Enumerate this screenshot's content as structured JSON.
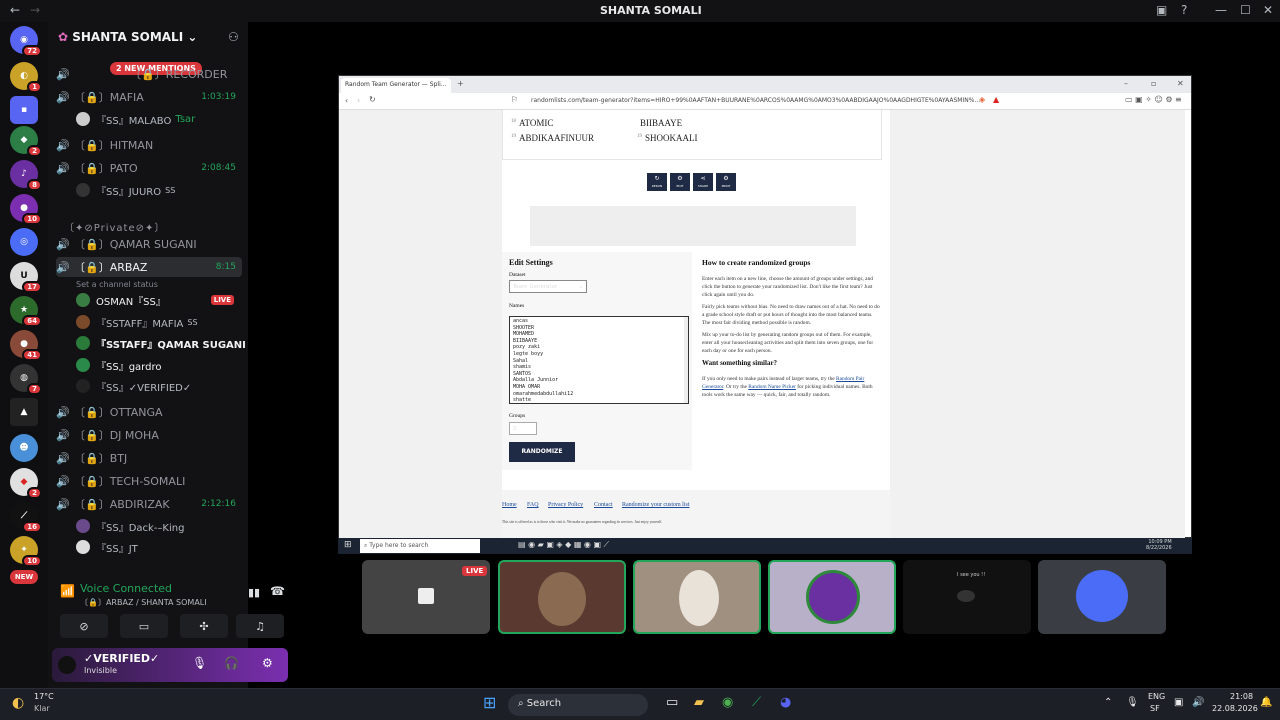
{
  "window": {
    "title": "SHANTA SOMALI"
  },
  "server": {
    "name": "SHANTA SOMALI",
    "mentions": "2 NEW MENTIONS"
  },
  "channels": [
    {
      "name": "〔🔒〕RECORDER",
      "time": ""
    },
    {
      "name": "〔🔒〕MAFIA",
      "time": "1:03:19"
    },
    {
      "name": "〔🔒〕HITMAN",
      "time": ""
    },
    {
      "name": "〔🔒〕PATO",
      "time": "2:08:45"
    },
    {
      "name": "〔🔒〕QAMAR SUGANI",
      "time": ""
    },
    {
      "name": "〔🔒〕ARBAZ",
      "time": "8:15"
    },
    {
      "name": "〔🔒〕OTTANGA",
      "time": ""
    },
    {
      "name": "〔🔒〕DJ MOHA",
      "time": ""
    },
    {
      "name": "〔🔒〕BTJ",
      "time": ""
    },
    {
      "name": "〔🔒〕TECH-SOMALI",
      "time": ""
    },
    {
      "name": "〔🔒〕ABDIRIZAK",
      "time": "2:12:16"
    }
  ],
  "category_private": "〔✦⊘Private⊘✦〕",
  "users": {
    "malabo": "『SS』MALABO",
    "malabo_tag": "Tsar",
    "juuro": "『SS』JUURO",
    "osman": "OSMAN『SS』",
    "live": "LIVE",
    "status_hint": "Set a channel status",
    "staff_mafia": "『SSTAFF』MAFIA",
    "staff_qamar": "『SSTAFF』QAMAR SUGANI",
    "gardro": "『SS』gardro",
    "verified": "『SS』✓VERIFIED✓",
    "dark": "『SS』Dack-–King",
    "jt": "『SS』JT",
    "ss_tag": "SS"
  },
  "voice": {
    "connected": "Voice Connected",
    "where": "〔🔒〕ARBAZ / SHANTA SOMALI"
  },
  "me": {
    "name": "✓VERIFIED✓",
    "status": "Invisible"
  },
  "browser": {
    "tab": "Random Team Generator — Spli...",
    "url": "randomlists.com/team-generator?items=HIRO+99%0AAFTAN+BUURANE%0ARCOS%0AAMG%0AMO3%0AABDIGAAJO%0AAGDHIGTE%0AYAASMIN%..."
  },
  "teams": [
    {
      "n": "18",
      "name": "ATOMIC"
    },
    {
      "n": "19",
      "name": "ABDIKAAFINUUR"
    },
    {
      "n": "",
      "name": "BIIBAAYE"
    },
    {
      "n": "19",
      "name": "SHOOKAALI"
    }
  ],
  "toolbar": [
    "RERUN",
    "EDIT",
    "SHARE",
    "PRINT"
  ],
  "edit": {
    "title": "Edit Settings",
    "dataset_label": "Dataset",
    "dataset": "Team Generator",
    "names_label": "Names",
    "names": [
      "ancas",
      "SHOOTER",
      "MOHAMED",
      "BIIBAAYE",
      "pozy zaki",
      "legte boyy",
      "Sahal",
      "shamis",
      "SANTOS",
      "Abdalla Junnior",
      "MOHA OMAR",
      "omarahmedabdullahi12",
      "shatte"
    ],
    "groups_label": "Groups",
    "groups": "2",
    "randomize": "RANDOMIZE"
  },
  "howto": {
    "title": "How to create randomized groups",
    "p1": "Enter each item on a new line, choose the amount of groups under settings, and click the button to generate your randomized list. Don't like the first team? Just click again until you do.",
    "p2": "Fairly pick teams without bias. No need to draw names out of a hat. No need to do a grade school style draft or put hours of thought into the most balanced teams. The most fair dividing method possible is random.",
    "p3": "Mix up your to-do list by generating random groups out of them. For example, enter all your housecleaning activities and split them into seven groups, one for each day or one for each person.",
    "title2": "Want something similar?",
    "p4a": "If you only need to make pairs instead of larger teams, try the ",
    "link1": "Random Pair Generator",
    "p4b": ". Or try the ",
    "link2": "Random Name Picker",
    "p4c": " for picking individual names. Both tools work the same way — quick, fair, and totally random."
  },
  "footer": {
    "links": [
      "Home",
      "FAQ",
      "Privacy Policy",
      "Contact",
      "Randomize your custom list"
    ],
    "note": "This site is offered as is to those who visit it. We make no guarantees regarding its services. Just enjoy yourself."
  },
  "inner_taskbar": {
    "search": "Type here to search",
    "time": "10:09 PM",
    "date": "8/22/2026"
  },
  "stream": {
    "live": "LIVE",
    "see": "I see you !!"
  },
  "taskbar": {
    "weather_temp": "17°C",
    "weather_desc": "Klar",
    "search": "Search",
    "lang": "ENG",
    "region": "SF",
    "time": "21:08",
    "date": "22.08.2026"
  }
}
